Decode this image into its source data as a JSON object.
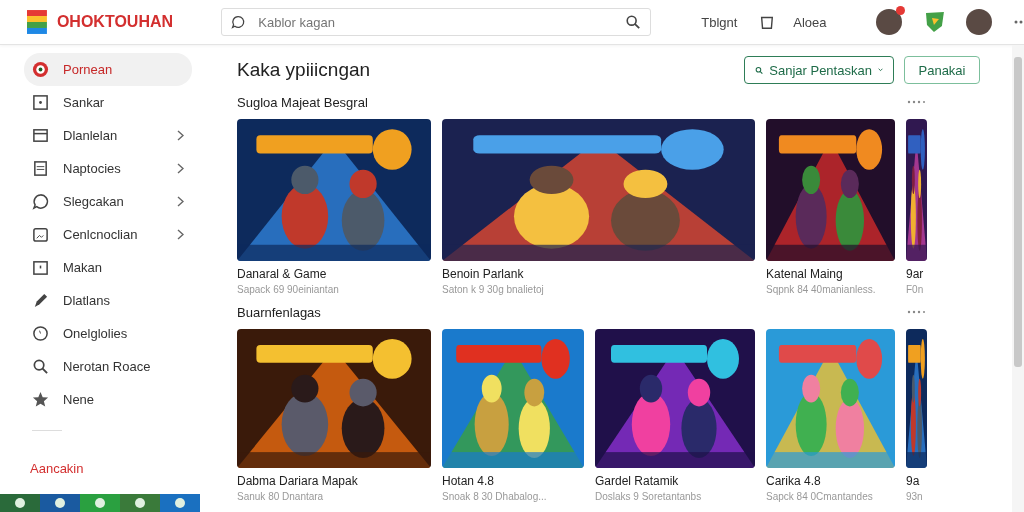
{
  "header": {
    "brand": "OHOKTOUHAN",
    "search": {
      "placeholder": "Kablor kagan"
    },
    "links": [
      "Tblgnt",
      "Aloea"
    ],
    "notification": true
  },
  "sidebar": {
    "items": [
      {
        "label": "Pornean",
        "selected": true,
        "expandable": false
      },
      {
        "label": "Sankar",
        "selected": false,
        "expandable": false
      },
      {
        "label": "Dlanlelan",
        "selected": false,
        "expandable": true
      },
      {
        "label": "Naptocies",
        "selected": false,
        "expandable": true
      },
      {
        "label": "Slegcakan",
        "selected": false,
        "expandable": true
      },
      {
        "label": "Cenlcnoclian",
        "selected": false,
        "expandable": true
      },
      {
        "label": "Makan",
        "selected": false,
        "expandable": false
      },
      {
        "label": "Dlatlans",
        "selected": false,
        "expandable": false
      },
      {
        "label": "Onelglolies",
        "selected": false,
        "expandable": false
      },
      {
        "label": "Nerotan Roace",
        "selected": false,
        "expandable": false
      },
      {
        "label": "Nene",
        "selected": false,
        "expandable": false
      }
    ],
    "footer_link": "Aancakin"
  },
  "page": {
    "title": "Kaka ypiiicngan",
    "filter_button": "Sanjar Pentaskan",
    "action_button": "Panakai"
  },
  "sections": [
    {
      "heading": "Sugloa Majeat Besgral",
      "cards": [
        {
          "title": "Danaral & Game",
          "subtitle": "Sapack 69 90einiantan"
        },
        {
          "title": "Benoin Parlank",
          "subtitle": "Saton k 9 30g bnalietoj"
        },
        {
          "title": "Katenal Maing",
          "subtitle": "Sqpnk 84 40manianless."
        },
        {
          "title": "9ar",
          "subtitle": "F0n"
        }
      ]
    },
    {
      "heading": "Buarnfenlagas",
      "cards": [
        {
          "title": "Dabma Dariara Mapak",
          "subtitle": "Sanuk 80 Dnantara"
        },
        {
          "title": "Hotan 4.8",
          "subtitle": "Snoak 8 30 Dhabalog..."
        },
        {
          "title": "Gardel Ratamik",
          "subtitle": "Doslaks 9 Soretantanbs"
        },
        {
          "title": "Carika 4.8",
          "subtitle": "Sapck 84 0Cmantandes"
        },
        {
          "title": "9a",
          "subtitle": "93n"
        }
      ]
    }
  ]
}
